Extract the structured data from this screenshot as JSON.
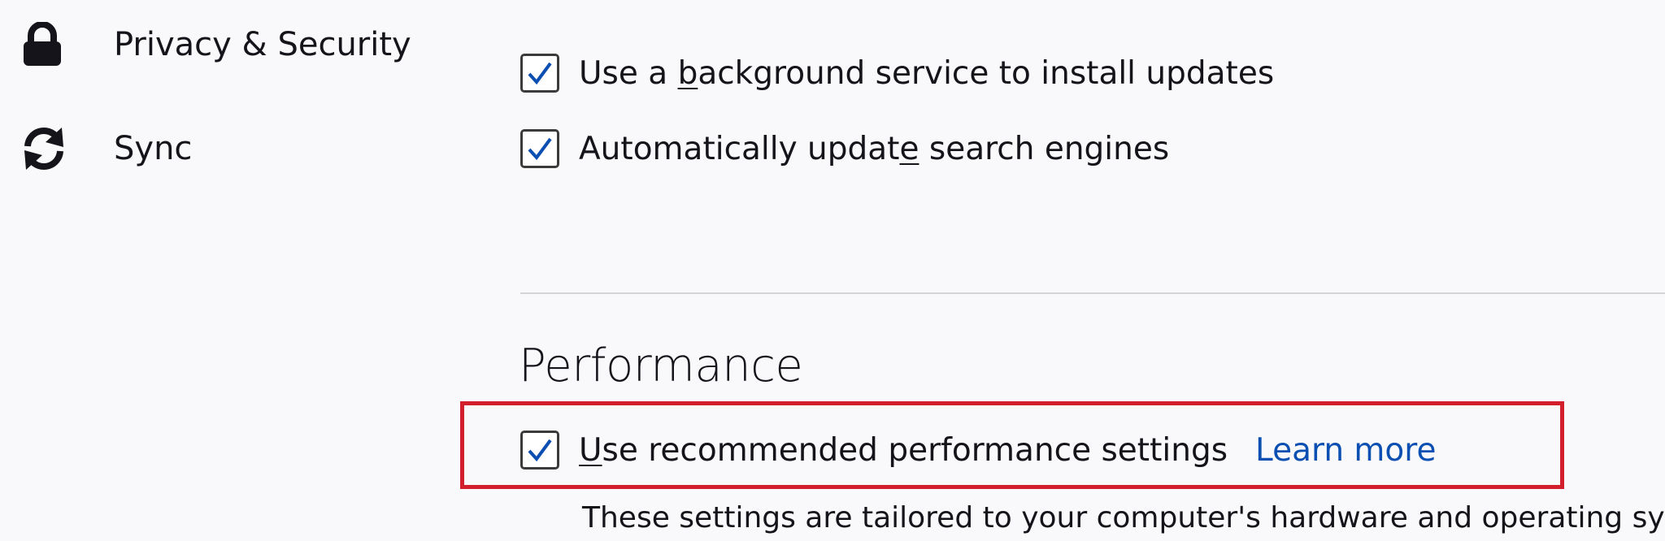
{
  "sidebar": {
    "items": [
      {
        "label": "Privacy & Security",
        "icon": "lock-icon"
      },
      {
        "label": "Sync",
        "icon": "sync-icon"
      }
    ]
  },
  "updates": {
    "background_service": {
      "label_pre": "Use a ",
      "label_accel": "b",
      "label_post": "ackground service to install updates",
      "checked": true
    },
    "search_engines": {
      "label_pre": "Automatically updat",
      "label_accel": "e",
      "label_post": " search engines",
      "checked": true
    }
  },
  "performance": {
    "title": "Performance",
    "recommended": {
      "label_accel": "U",
      "label_post": "se recommended performance settings",
      "checked": true
    },
    "learn_more": "Learn more",
    "description": "These settings are tailored to your computer's hardware and operating system."
  },
  "colors": {
    "highlight_border": "#d21f2b",
    "link": "#0a4fb1",
    "background": "#f9f9fb"
  }
}
